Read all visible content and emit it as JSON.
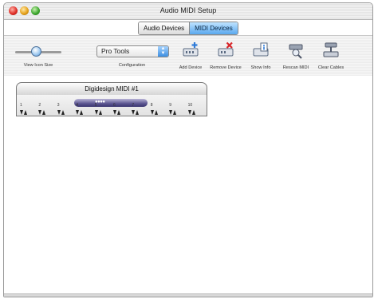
{
  "window": {
    "title": "Audio MIDI Setup"
  },
  "tabs": [
    {
      "label": "Audio Devices",
      "active": false
    },
    {
      "label": "MIDI Devices",
      "active": true
    }
  ],
  "toolbar": {
    "icon_size_label": "View Icon Size",
    "icon_size_level": 0.45,
    "configuration_label": "Configuration",
    "configuration_value": "Pro Tools",
    "add_device_label": "Add Device",
    "remove_device_label": "Remove Device",
    "show_info_label": "Show Info",
    "rescan_midi_label": "Rescan MIDI",
    "clear_cables_label": "Clear Cables"
  },
  "device": {
    "name": "Digidesign MIDI #1",
    "ports": [
      "1",
      "2",
      "3",
      "4",
      "5",
      "6",
      "7",
      "8",
      "9",
      "10"
    ]
  },
  "colors": {
    "active_tab": "#5aa9ef",
    "close_button": "#e0302a",
    "minimize_button": "#e6a21c",
    "zoom_button": "#3fa830",
    "device_unit": "#5a548f"
  }
}
